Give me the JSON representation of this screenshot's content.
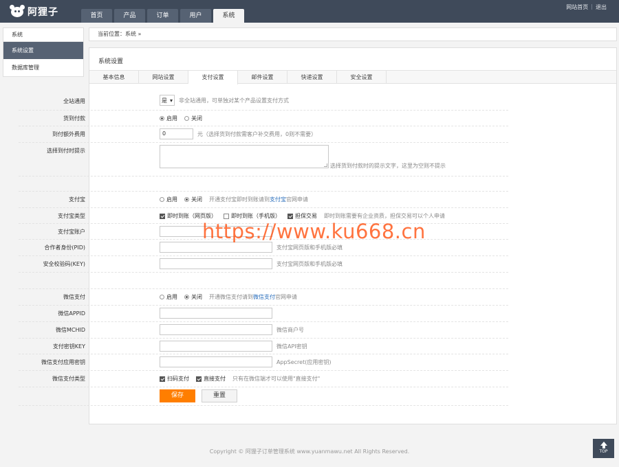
{
  "logo": {
    "text": "阿狸子"
  },
  "nav": {
    "tabs": [
      "首页",
      "产品",
      "订单",
      "用户",
      "系统"
    ],
    "active": 4
  },
  "top_links": {
    "home": "网站首页",
    "sep": "|",
    "logout": "退出"
  },
  "sidebar": {
    "header": "系统",
    "items": [
      "系统设置",
      "数据库管理"
    ]
  },
  "breadcrumb": {
    "label": "当前位置：",
    "current": "系统",
    "arrow": "»"
  },
  "panel": {
    "title": "系统设置"
  },
  "subtabs": [
    "基本信息",
    "网站设置",
    "支付设置",
    "邮件设置",
    "快递设置",
    "安全设置"
  ],
  "cod": {
    "global_label": "全站通用",
    "global_value": "是",
    "global_hint": "非全站通用，可单独对某个产品设置支付方式",
    "cod_label": "货到付款",
    "enable": "启用",
    "disable": "关闭",
    "fee_label": "到付额外费用",
    "fee_value": "0",
    "fee_hint": "元（选择货到付款需客户补交费用，0则不需要）",
    "tip_label": "选择到付时提示",
    "tip_hint": "选择货到付款时的提示文字，这里为空则不提示"
  },
  "alipay": {
    "label": "支付宝",
    "enable": "启用",
    "disable": "关闭",
    "hint_pre": "开通支付宝即时到账请到",
    "hint_link": "支付宝",
    "hint_post": "官网申请",
    "type_label": "支付宝类型",
    "type_opts": [
      "即时到账（网页版）",
      "即时到账（手机版）",
      "担保交易"
    ],
    "type_hint": "即时到账需要有企业资质，担保交易可以个人申请",
    "account_label": "支付宝账户",
    "pid_label": "合作者身份(PID)",
    "pid_hint": "支付宝网页版和手机版必填",
    "key_label": "安全校验码(KEY)",
    "key_hint": "支付宝网页版和手机版必填"
  },
  "wechat": {
    "label": "微信支付",
    "enable": "启用",
    "disable": "关闭",
    "hint_pre": "开通微信支付请到",
    "hint_link": "微信支付",
    "hint_post": "官网申请",
    "appid_label": "微信APPID",
    "mchid_label": "微信MCHID",
    "mchid_hint": "微信商户号",
    "key_label": "支付密钥KEY",
    "key_hint": "微信API密钥",
    "secret_label": "微信支付应用密钥",
    "secret_hint": "AppSecret(应用密钥)",
    "type_label": "微信支付类型",
    "type_opts": [
      "扫码支付",
      "直接支付"
    ],
    "type_hint": "只有在微信端才可以使用\"直接支付\""
  },
  "buttons": {
    "save": "保存",
    "reset": "重置"
  },
  "watermark": "https://www.ku668.cn",
  "footer": "Copyright © 阿狸子订单管理系统 www.yuanmawu.net All Rights Reserved.",
  "totop": "TOP",
  "colors": {
    "topbar": "#3f4a5a",
    "accent": "#ff7e00",
    "link": "#2a6ebb",
    "watermark": "#ff4500"
  }
}
